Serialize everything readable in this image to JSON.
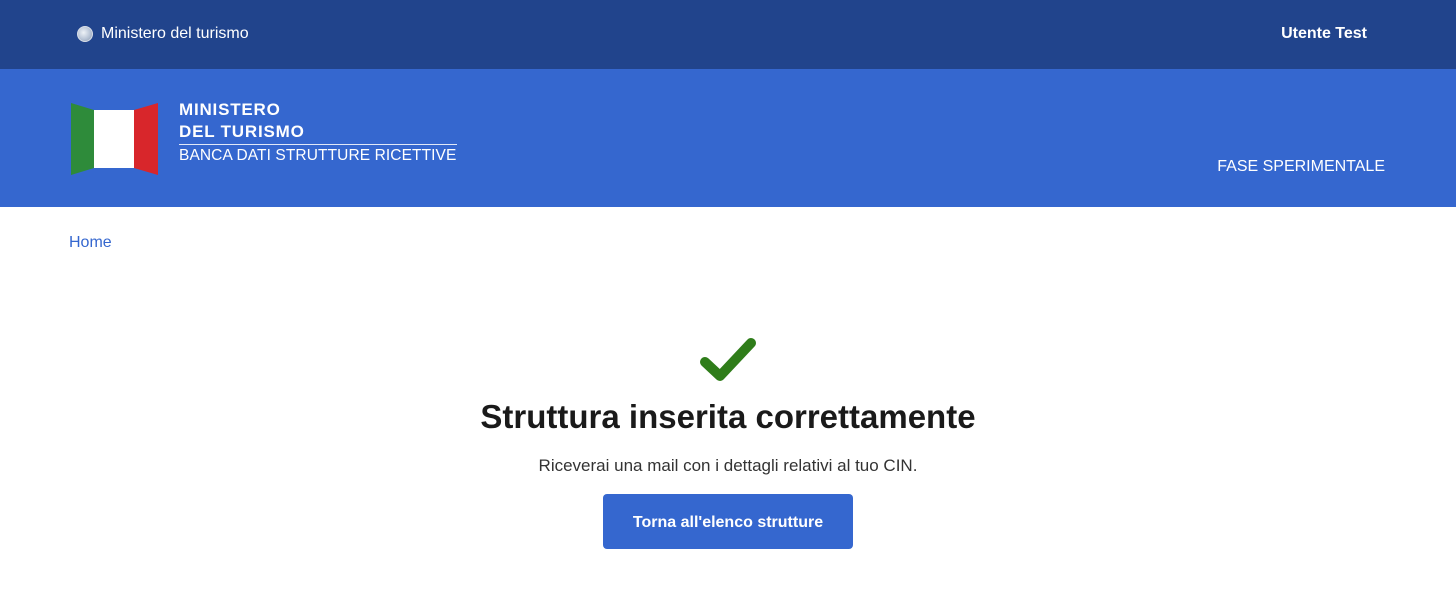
{
  "top_bar": {
    "ministry_link": "Ministero del turismo",
    "user_name": "Utente Test",
    "background_color": "#21448c"
  },
  "header": {
    "title_line1": "MINISTERO",
    "title_line2": "DEL TURISMO",
    "subtitle": "BANCA DATI STRUTTURE RICETTIVE",
    "phase": "FASE SPERIMENTALE",
    "background_color": "#3567cf",
    "logo_colors": [
      "#2e8b3a",
      "#ffffff",
      "#d8262b"
    ]
  },
  "breadcrumb": {
    "home": "Home"
  },
  "success": {
    "icon": "check-icon",
    "icon_color": "#2f7d1a",
    "title": "Struttura inserita correttamente",
    "message": "Riceverai una mail con i dettagli relativi al tuo CIN.",
    "button_label": "Torna all'elenco strutture"
  }
}
